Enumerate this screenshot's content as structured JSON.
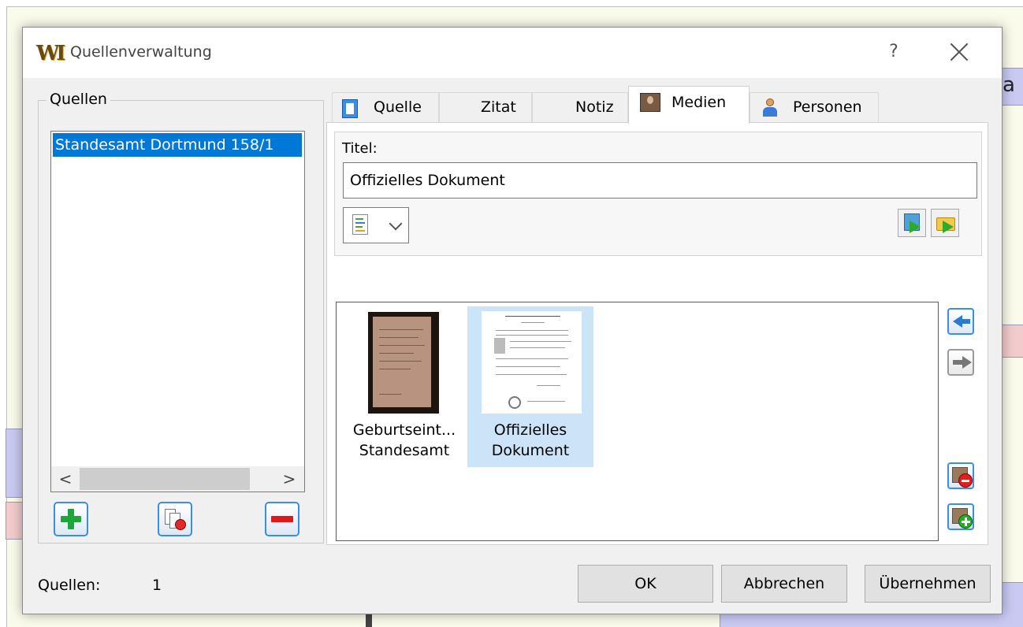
{
  "dialog": {
    "title": "Quellenverwaltung",
    "help_label": "?"
  },
  "sources": {
    "group_label": "Quellen",
    "items": [
      "Standesamt Dortmund 158/1"
    ],
    "scroll_left": "<",
    "scroll_right": ">"
  },
  "tabs": [
    {
      "label": "Quelle",
      "icon": "book-icon"
    },
    {
      "label": "Zitat",
      "icon": ""
    },
    {
      "label": "Notiz",
      "icon": ""
    },
    {
      "label": "Medien",
      "icon": "photo-icon"
    },
    {
      "label": "Personen",
      "icon": "person-icon"
    }
  ],
  "media": {
    "title_label": "Titel:",
    "title_value": "Offizielles Dokument",
    "items": [
      {
        "caption_line1": "Geburtseint...",
        "caption_line2": "Standesamt",
        "selected": false
      },
      {
        "caption_line1": "Offizielles",
        "caption_line2": "Dokument",
        "selected": true
      }
    ]
  },
  "status": {
    "label": "Quellen:",
    "count": "1"
  },
  "buttons": {
    "ok": "OK",
    "cancel": "Abbrechen",
    "apply": "Übernehmen"
  },
  "colors": {
    "selection": "#0078d7",
    "selected_media": "#cce4f7",
    "accent_border": "#3a8ee6"
  }
}
